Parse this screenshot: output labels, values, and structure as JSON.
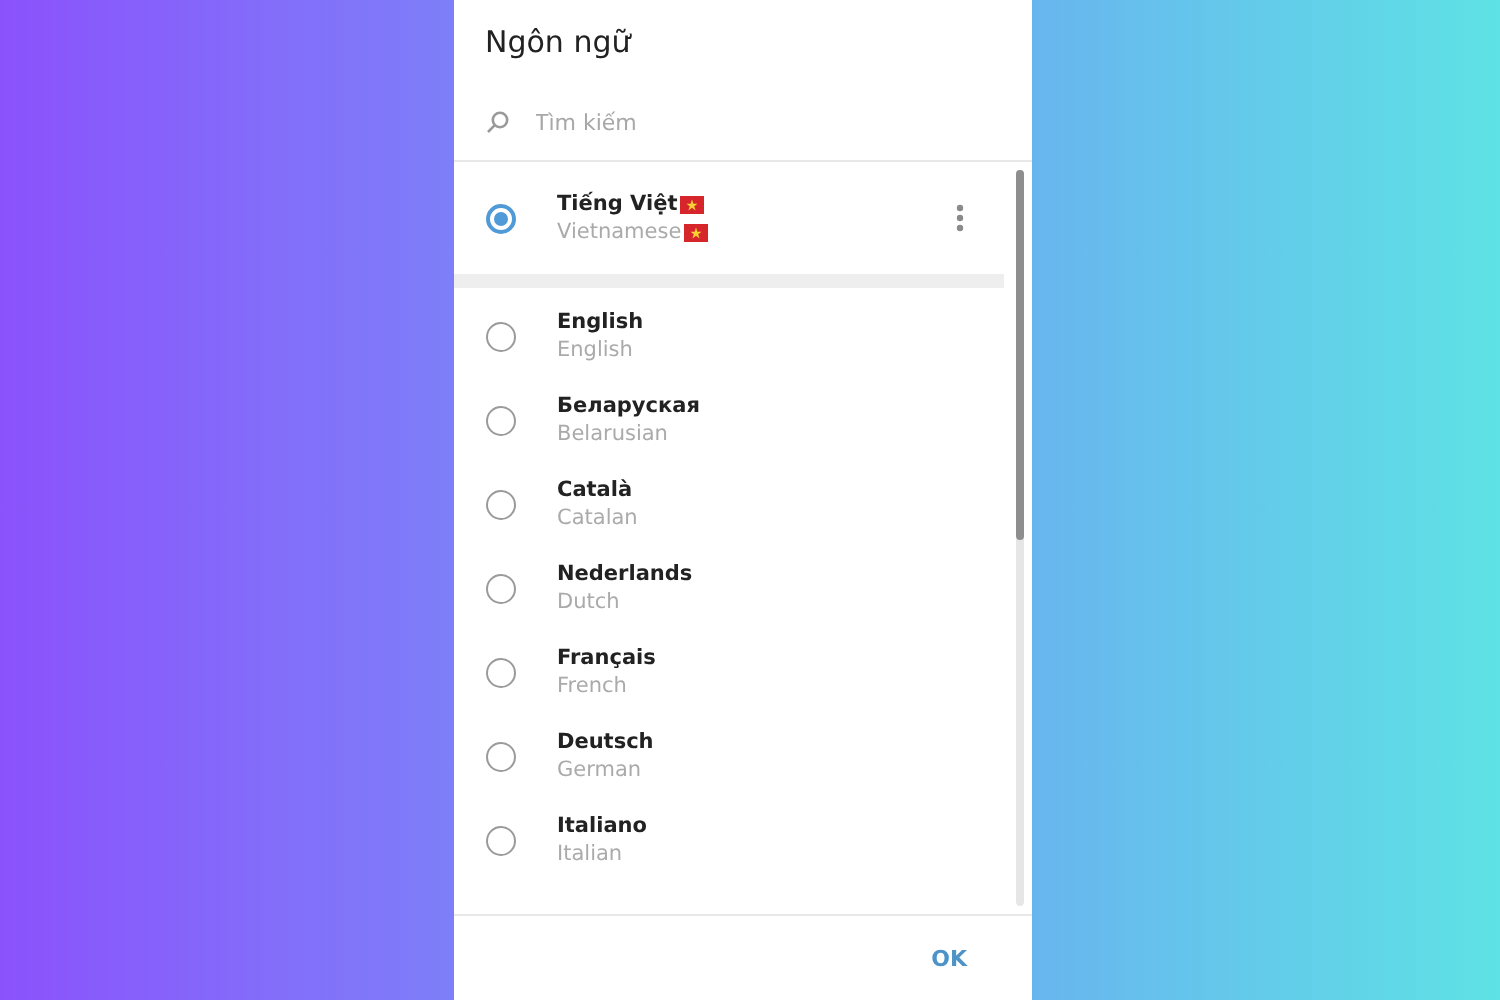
{
  "dialog": {
    "title": "Ngôn ngữ",
    "search": {
      "placeholder": "Tìm kiếm"
    },
    "current": {
      "name": "Tiếng Việt",
      "native": "Vietnamese",
      "flag": true,
      "selected": true
    },
    "languages": [
      {
        "name": "English",
        "native": "English",
        "selected": false
      },
      {
        "name": "Беларуская",
        "native": "Belarusian",
        "selected": false
      },
      {
        "name": "Català",
        "native": "Catalan",
        "selected": false
      },
      {
        "name": "Nederlands",
        "native": "Dutch",
        "selected": false
      },
      {
        "name": "Français",
        "native": "French",
        "selected": false
      },
      {
        "name": "Deutsch",
        "native": "German",
        "selected": false
      },
      {
        "name": "Italiano",
        "native": "Italian",
        "selected": false
      }
    ],
    "buttons": [
      "OK"
    ]
  }
}
